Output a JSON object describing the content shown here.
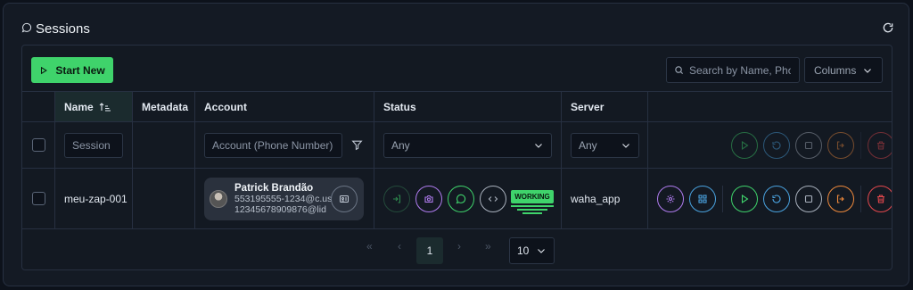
{
  "header": {
    "title": "Sessions"
  },
  "toolbar": {
    "start_label": "Start New",
    "search_placeholder": "Search by Name, Phone",
    "columns_label": "Columns"
  },
  "columns": [
    "Name",
    "Metadata",
    "Account",
    "Status",
    "Server"
  ],
  "filters": {
    "session_placeholder": "Session",
    "account_placeholder": "Account (Phone Number)",
    "status_value": "Any",
    "server_value": "Any"
  },
  "rows": [
    {
      "name": "meu-zap-001",
      "account": {
        "display_name": "Patrick Brandão",
        "phone": "553195555-1234@c.us",
        "lid": "12345678909876@lid"
      },
      "status": "WORKING",
      "server": "waha_app"
    }
  ],
  "pagination": {
    "current_page": "1",
    "page_size": "10"
  },
  "colors": {
    "accent": "#3fd36b",
    "play": "#3fd36b",
    "restart": "#4aa3e0",
    "stop": "#a9b1bd",
    "logout": "#f08a3c",
    "delete": "#e5484d",
    "config": "#b07cf0",
    "grid": "#4aa3e0"
  }
}
